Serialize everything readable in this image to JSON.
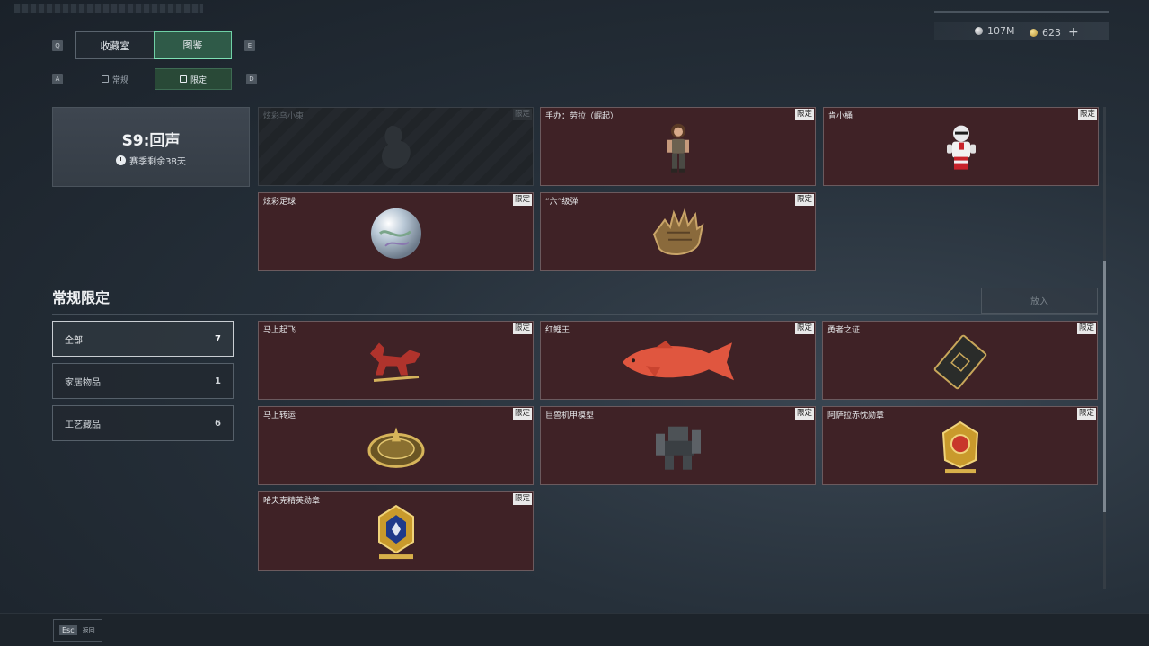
{
  "currency": {
    "silver": "107M",
    "gold": "623",
    "plus": "+"
  },
  "key_hints": {
    "prev_tab": "Q",
    "next_tab": "E",
    "prev_sub": "A",
    "next_sub": "D"
  },
  "tabs": [
    {
      "label": "收藏室"
    },
    {
      "label": "图鉴"
    }
  ],
  "subtabs": [
    {
      "label": "常规"
    },
    {
      "label": "限定"
    }
  ],
  "season": {
    "title": "S9:回声",
    "subtitle": "赛季剩余38天"
  },
  "limited_tag": "限定",
  "season_cards": [
    {
      "name": "炫彩乌小東",
      "locked": true
    },
    {
      "name": "手办：劳拉（崛起）",
      "locked": false
    },
    {
      "name": "肯小桶",
      "locked": false
    },
    {
      "name": "炫彩足球",
      "locked": false
    },
    {
      "name": "“六”级弹",
      "locked": false
    }
  ],
  "section": {
    "title": "常规限定",
    "put_in_label": "放入"
  },
  "filters": [
    {
      "label": "全部",
      "count": "7"
    },
    {
      "label": "家居物品",
      "count": "1"
    },
    {
      "label": "工艺藏品",
      "count": "6"
    }
  ],
  "regular_cards": [
    {
      "name": "马上起飞"
    },
    {
      "name": "红鲤王"
    },
    {
      "name": "勇者之证"
    },
    {
      "name": "马上转运"
    },
    {
      "name": "巨兽机甲模型"
    },
    {
      "name": "阿萨拉赤忱勋章"
    },
    {
      "name": "哈夫克精英勋章"
    }
  ],
  "footer": {
    "esc_key": "Esc",
    "back_label": "返回"
  }
}
